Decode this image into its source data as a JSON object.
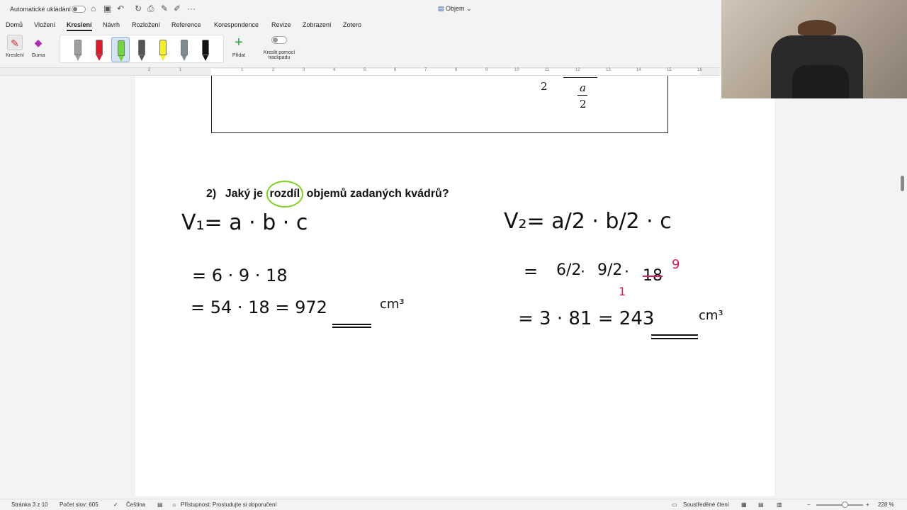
{
  "titlebar": {
    "autosave_label": "Automatické ukládání",
    "doc_title": "Objem"
  },
  "menu": [
    "Domů",
    "Vložení",
    "Kreslení",
    "Návrh",
    "Rozložení",
    "Reference",
    "Korespondence",
    "Revize",
    "Zobrazení",
    "Zotero"
  ],
  "ribbon": {
    "draw_label": "Kreslení",
    "eraser_label": "Guma",
    "add_label": "Přidat",
    "trackpad_label_1": "Kreslit pomocí",
    "trackpad_label_2": "trackpadu",
    "pens": [
      {
        "color": "#9e9e9e"
      },
      {
        "color": "#e0192b"
      },
      {
        "color": "#6fd83a"
      },
      {
        "color": "#555555"
      },
      {
        "color": "#f4f020"
      },
      {
        "color": "#7d8b94"
      },
      {
        "color": "#111111"
      }
    ]
  },
  "ruler": [
    "2",
    "1",
    "1",
    "2",
    "3",
    "4",
    "5",
    "6",
    "7",
    "8",
    "9",
    "10",
    "11",
    "12",
    "13",
    "14",
    "15",
    "16"
  ],
  "figure": {
    "left_denominator": "2",
    "frac_numerator": "a",
    "frac_denominator": "2"
  },
  "question": {
    "number": "2)",
    "before": "Jaký je",
    "highlight": "rozdíl",
    "after": "objemů zadaných kvádrů?"
  },
  "handwriting": {
    "v1": {
      "line1": "V₁= a · b · c",
      "line2": "= 6 · 9 · 18",
      "line3": "= 54 · 18 = 972",
      "unit": "cm³"
    },
    "v2": {
      "line1": "V₂= a/2 · b/2 · c",
      "line2_a": "6/2",
      "line2_b": "9/2",
      "line2_c": "18",
      "line2_note_1": "1",
      "line2_note_9": "9",
      "line3": "= 3 · 81 = 243",
      "unit": "cm³"
    }
  },
  "status": {
    "page": "Stránka 3 z 10",
    "words": "Počet slov: 605",
    "language": "Čeština",
    "accessibility": "Přístupnost: Prostudujte si doporučení",
    "focus": "Soustředěné čtení",
    "zoom": "228 %"
  }
}
